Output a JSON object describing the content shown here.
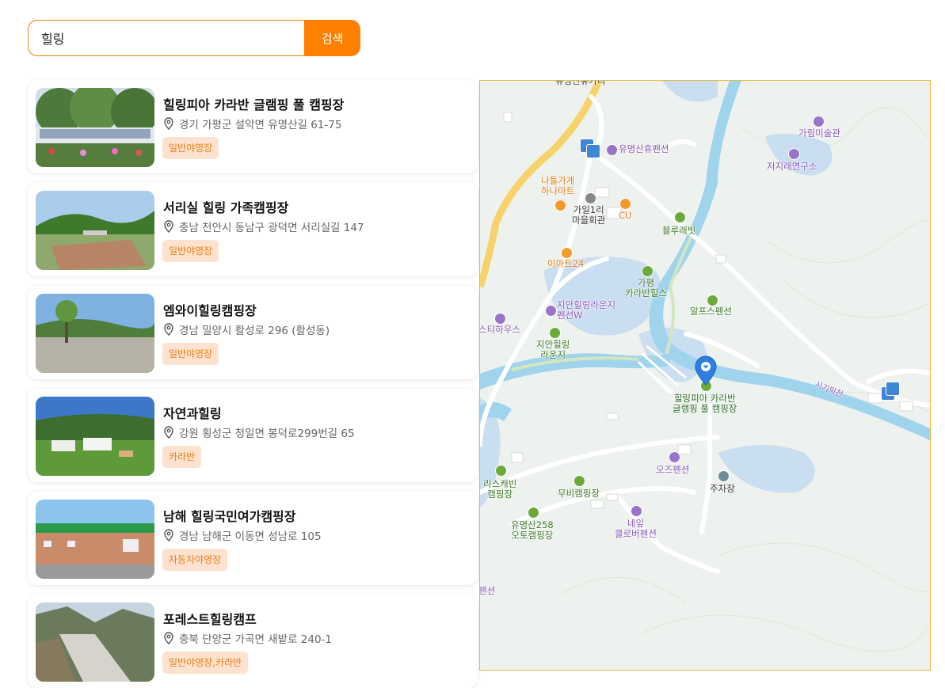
{
  "search": {
    "value": "힐링",
    "button_label": "검색"
  },
  "results": [
    {
      "title": "힐링피아 카라반 글램핑 풀 캠핑장",
      "address": "경기 가평군 설악면 유명산길 61-75",
      "tag": "일반야영장"
    },
    {
      "title": "서리실 힐링 가족캠핑장",
      "address": "충남 천안시 동남구 광덕면 서리실길 147",
      "tag": "일반야영장"
    },
    {
      "title": "엠와이힐링캠핑장",
      "address": "경남 밀양시 활성로 296 (활성동)",
      "tag": "일반야영장"
    },
    {
      "title": "자연과힐링",
      "address": "강원 횡성군 청일면 봉덕로299번길 65",
      "tag": "카라반"
    },
    {
      "title": "남해 힐링국민여가캠핑장",
      "address": "경남 남해군 이동면 성남로 105",
      "tag": "자동차야영장"
    },
    {
      "title": "포레스트힐링캠프",
      "address": "충북 단양군 가곡면 새밭로 240-1",
      "tag": "일반야영장,카라반"
    }
  ],
  "map": {
    "labels": {
      "top_cut": "유명산휴카리",
      "gallery": "가림미술관",
      "pension1": "유명산휴펜션",
      "research": "저지레연구소",
      "mart1": "나들가게\n하나마트",
      "hall": "가일1리\n마을회관",
      "cu": "CU",
      "bluelabit": "블루래빗",
      "emart": "이마트24",
      "gapyeong": "가평\n카라반힐스",
      "zian_pension": "지안힐링라운지\n펜션W",
      "alps": "알프스펜션",
      "stihouse": "스티하우스",
      "zian_lounge": "지안힐링\n라운지",
      "target": "힐링피아 카라반\n글램핑 풀 캠핑장",
      "stream": "사기막천",
      "oz": "오즈펜션",
      "parking": "주차장",
      "richbin": "리스캐빈\n캠핑장",
      "mubi": "무비캠핑장",
      "clover": "네잎\n클로버펜션",
      "ymc258": "유명산258\n오토캠핑장",
      "pension_cut": "펜션"
    },
    "colors": {
      "water": "#9fd4ec",
      "road": "#ffffff",
      "highway": "#f6d36a",
      "pin": "#2f7fe0"
    }
  }
}
